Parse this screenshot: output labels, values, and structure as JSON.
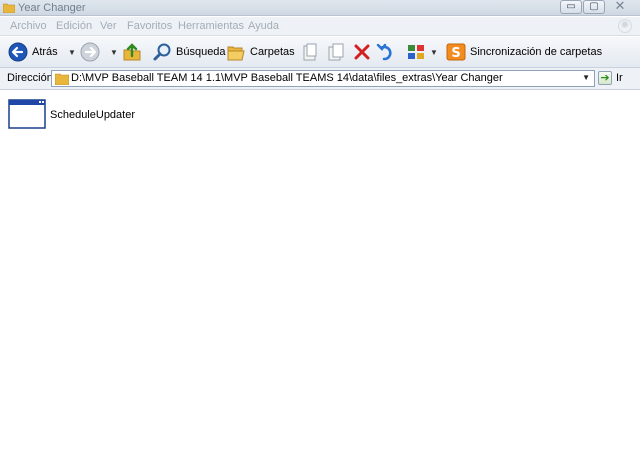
{
  "window": {
    "title": "Year Changer",
    "controls": {
      "minimize": "▭",
      "maximize": "▢",
      "close": "✕"
    }
  },
  "menu": [
    "Archivo",
    "Edición",
    "Ver",
    "Favoritos",
    "Herramientas",
    "Ayuda"
  ],
  "toolbar": {
    "back_label": "Atrás",
    "search_label": "Búsqueda",
    "folders_label": "Carpetas",
    "sync_label": "Sincronización de carpetas"
  },
  "address": {
    "label": "Dirección",
    "path": "D:\\MVP Baseball TEAM 14 1.1\\MVP Baseball TEAMS 14\\data\\files_extras\\Year Changer",
    "go_label": "Ir"
  },
  "files": [
    {
      "name": "ScheduleUpdater",
      "icon": "application-window-icon"
    }
  ],
  "colors": {
    "accent": "#1f57b8",
    "disabled_menu": "#a3acb6",
    "folder": "#e8b63a"
  }
}
